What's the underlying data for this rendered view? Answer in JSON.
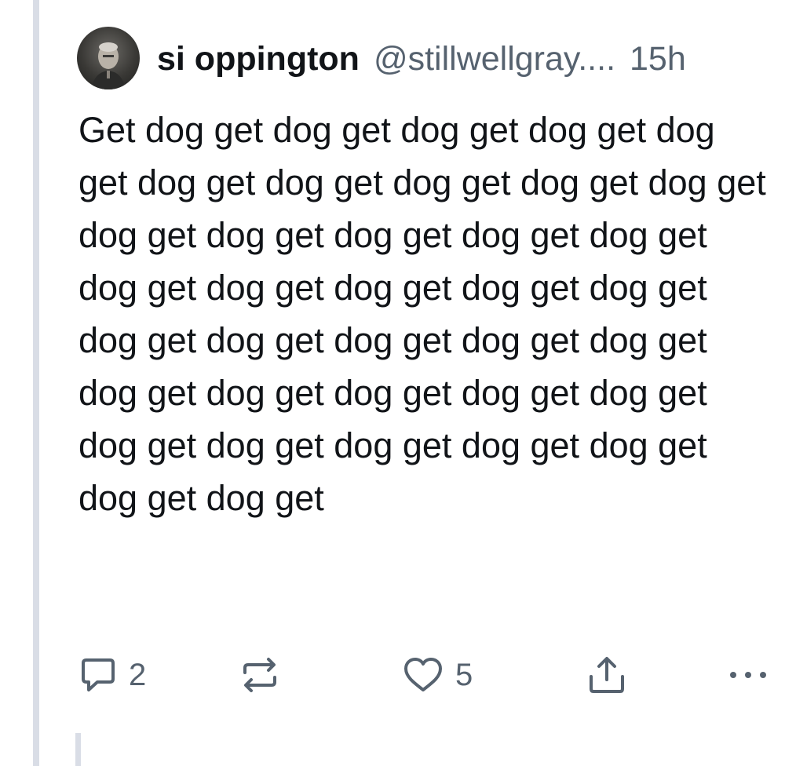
{
  "post": {
    "author": {
      "display_name": "si oppington",
      "handle": "@stillwellgray...."
    },
    "timestamp": "15h",
    "text": "Get dog get dog get dog get dog get dog get dog get dog get dog get dog get dog get dog get dog get dog get dog get dog get dog get dog get dog get dog get dog get dog get dog get dog get dog get dog get dog get dog get dog get dog get dog get dog get dog get dog get dog get dog get dog get dog get"
  },
  "actions": {
    "reply": {
      "icon": "speech-bubble-icon",
      "count": "2"
    },
    "repost": {
      "icon": "repost-arrows-icon"
    },
    "like": {
      "icon": "heart-icon",
      "count": "5"
    },
    "share": {
      "icon": "share-upload-icon"
    },
    "more": {
      "icon": "ellipsis-icon"
    }
  },
  "colors": {
    "text": "#111418",
    "secondary": "#56626f",
    "thread_line": "#d9dde6"
  }
}
